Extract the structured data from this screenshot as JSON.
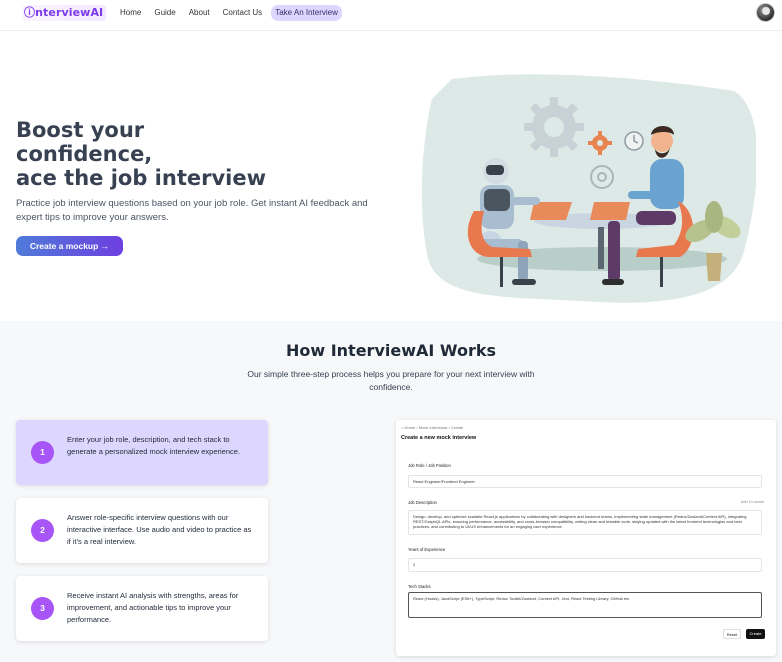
{
  "nav": {
    "logo": "ⓘnterviewAI",
    "links": [
      "Home",
      "Guide",
      "About",
      "Contact Us",
      "Take An Interview"
    ]
  },
  "hero": {
    "title_lines": [
      "Boost your",
      "confidence,",
      "ace the job interview"
    ],
    "subtitle": "Practice job interview questions based on your job role. Get instant AI feedback and expert tips to improve your answers.",
    "cta_label": "Create a mockup →"
  },
  "how": {
    "title": "How InterviewAI Works",
    "subtitle": "Our simple three-step process helps you prepare for your next interview with confidence.",
    "steps": [
      {
        "num": "1",
        "text": "Enter your job role, description, and tech stack to generate a personalized mock interview experience."
      },
      {
        "num": "2",
        "text": "Answer role-specific interview questions with our interactive interface. Use audio and video to practice as if it's a real interview."
      },
      {
        "num": "3",
        "text": "Receive instant AI analysis with strengths, areas for improvement, and actionable tips to improve your performance."
      }
    ]
  },
  "mock": {
    "breadcrumb": "⌂ Home  ›  Mock Interviews  ›  Create",
    "heading": "Create a new mock interview",
    "role_label": "Job Role / Job Position",
    "role_value": "React Engineer/Frontend Engineer",
    "desc_label": "Job Description",
    "desc_counter": "Add 10 words",
    "desc_value": "Design, develop, and optimize scalable React.js applications by collaborating with designers and backend teams. Implementing state management (Redux/Zustand/Context API), integrating REST/GraphQL APIs, ensuring performance, accessibility, and cross-browser compatibility, writing clean and testable code, staying updated with the latest frontend technologies and best practices, and contributing to UI/UX enhancements for an engaging user experience.",
    "exp_label": "Years of Experience",
    "exp_value": "2",
    "stack_label": "Tech Stacks",
    "stack_value": "React (Hooks), JavaScript (ES6+), TypeScript, Redux Toolkit/Zustand, Context API, Jest, React Testing Library, GitHub etc",
    "reset_label": "Reset",
    "create_label": "Create"
  },
  "colors": {
    "accent": "#a855f7",
    "active_tab": "#ddd6fe",
    "cta_start": "#4f7bd9",
    "cta_end": "#6d3fe0"
  }
}
